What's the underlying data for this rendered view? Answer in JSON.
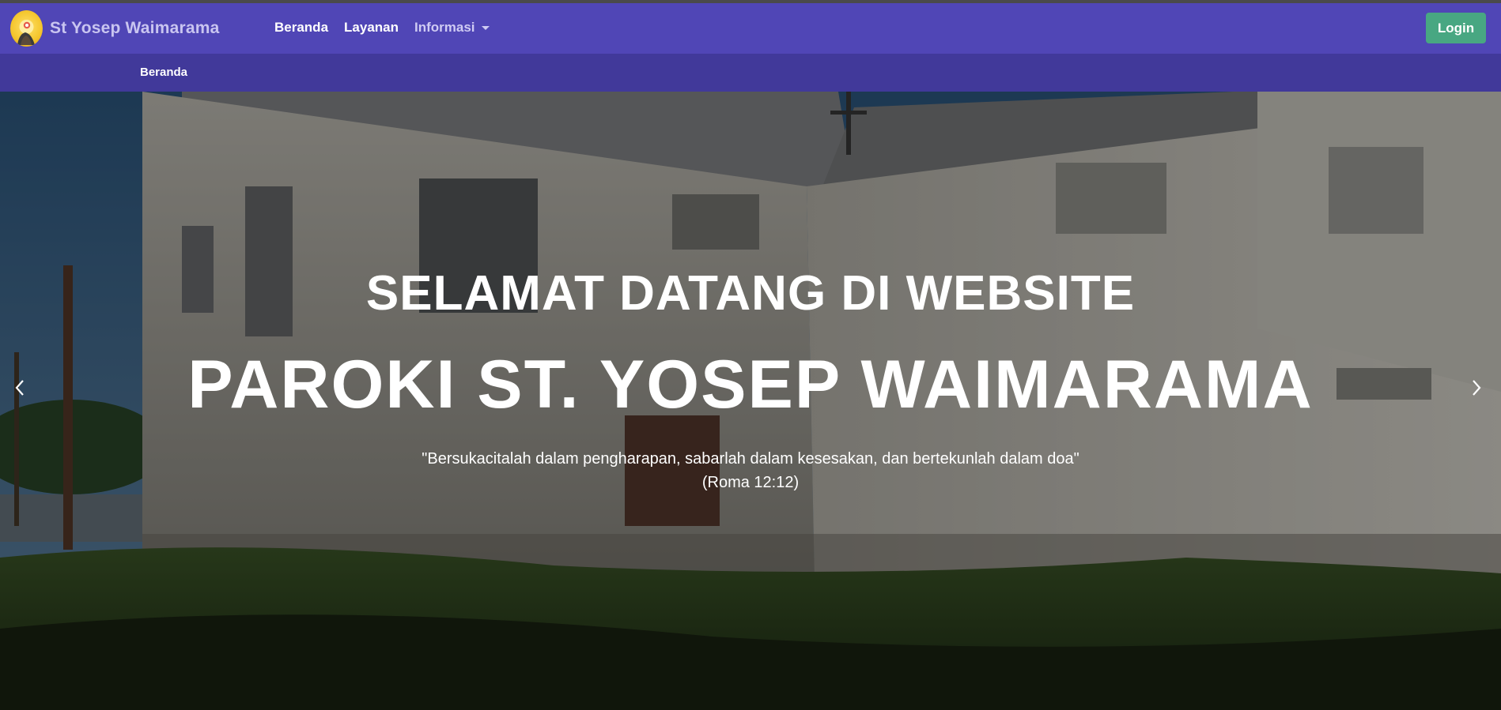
{
  "navbar": {
    "brand": "St Yosep Waimarama",
    "links": [
      {
        "label": "Beranda"
      },
      {
        "label": "Layanan"
      },
      {
        "label": "Informasi"
      }
    ],
    "login_label": "Login",
    "colors": {
      "navbar": "#5046b6",
      "subnav": "#41399a",
      "login": "#48a782"
    }
  },
  "breadcrumb": {
    "current": "Beranda"
  },
  "hero": {
    "welcome": "SELAMAT DATANG DI WEBSITE",
    "parish": "PAROKI ST. YOSEP WAIMARAMA",
    "verse": "\"Bersukacitalah dalam pengharapan, sabarlah dalam kesesakan, dan bertekunlah dalam doa\"",
    "verse_ref": "(Roma 12:12)",
    "prev_icon": "chevron-left-icon",
    "next_icon": "chevron-right-icon"
  }
}
